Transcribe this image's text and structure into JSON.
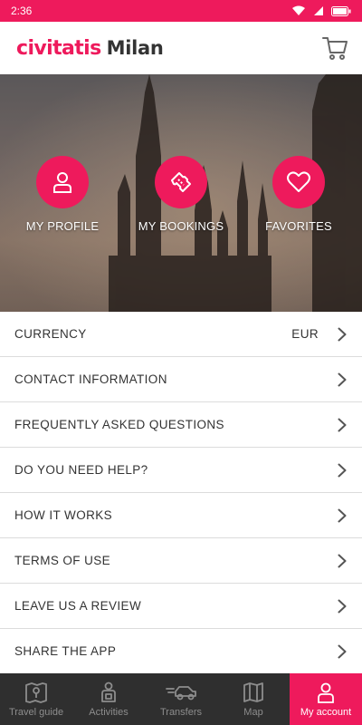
{
  "status_bar": {
    "time": "2:36",
    "bg_color": "#ee1a5c"
  },
  "header": {
    "brand": "civitatis",
    "city": "Milan",
    "cart_icon": "shopping-cart-icon"
  },
  "hero": {
    "items": [
      {
        "label": "MY PROFILE",
        "icon": "user-icon"
      },
      {
        "label": "MY BOOKINGS",
        "icon": "ticket-icon"
      },
      {
        "label": "FAVORITES",
        "icon": "heart-icon"
      }
    ]
  },
  "menu": {
    "items": [
      {
        "label": "CURRENCY",
        "value": "EUR"
      },
      {
        "label": "CONTACT INFORMATION"
      },
      {
        "label": "FREQUENTLY ASKED QUESTIONS"
      },
      {
        "label": "DO YOU NEED HELP?"
      },
      {
        "label": "HOW IT WORKS"
      },
      {
        "label": "TERMS OF USE"
      },
      {
        "label": "LEAVE US A REVIEW"
      },
      {
        "label": "SHARE THE APP"
      }
    ]
  },
  "tabbar": {
    "tabs": [
      {
        "label": "Travel guide",
        "icon": "map-guide-icon"
      },
      {
        "label": "Activities",
        "icon": "activities-icon"
      },
      {
        "label": "Transfers",
        "icon": "car-icon"
      },
      {
        "label": "Map",
        "icon": "map-icon"
      },
      {
        "label": "My account",
        "icon": "user-icon",
        "active": true
      }
    ]
  },
  "colors": {
    "accent": "#ee1a5c",
    "tabbar": "#2f2f2f"
  }
}
